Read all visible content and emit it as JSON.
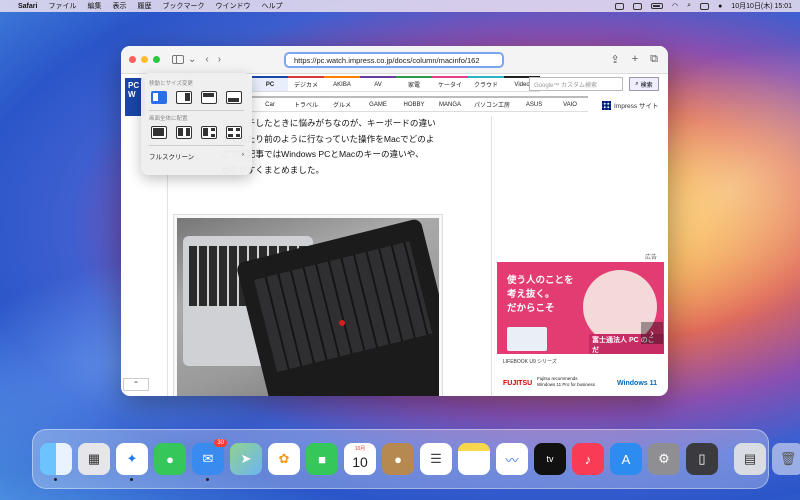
{
  "menubar": {
    "app_name": "Safari",
    "items": [
      "ファイル",
      "編集",
      "表示",
      "履歴",
      "ブックマーク",
      "ウインドウ",
      "ヘルプ"
    ],
    "datetime": "10月10日(木) 15:01"
  },
  "browser": {
    "url": "https://pc.watch.impress.co.jp/docs/column/macinfo/162"
  },
  "site": {
    "logo_text": "PC W",
    "nav_row1": [
      "PC",
      "デジカメ",
      "AKIBA",
      "AV",
      "家電",
      "ケータイ",
      "クラウド",
      "Video"
    ],
    "nav_row2": [
      "Car",
      "トラベル",
      "グルメ",
      "GAME",
      "HOBBY",
      "MANGA",
      "パソコン工房",
      "ASUS",
      "VAIO"
    ],
    "search_placeholder": "Google™ カスタム検索",
    "search_button": "検索",
    "impress_sites": "Impress サイト"
  },
  "article": {
    "lines": [
      "スイッチしたときに悩みがちなのが、キーボードの違い",
      "まで当たり前のように行なっていた操作をMacでどのよ",
      "こで本記事ではWindows PCとMacのキーの違いや、",
      "かりやすくまとめました。"
    ]
  },
  "ad": {
    "label": "広告",
    "headline": [
      "使う人のことを",
      "考え抜く。",
      "だからこそ"
    ],
    "corp": "富士通法人 PC のこだ",
    "product": "LIFEBOOK U9 シリーズ",
    "recommend": [
      "Fujitsu recommends",
      "Windows 11 Pro for business"
    ],
    "brand": "FUJITSU",
    "windows": "Windows 11"
  },
  "popover": {
    "section1_label": "移動とサイズ変更",
    "section2_label": "画面全体に配置",
    "fullscreen_label": "フルスクリーン"
  },
  "dock": {
    "mail_badge": "30",
    "calendar_month": "10月",
    "calendar_day": "10",
    "apps": [
      "Finder",
      "Launchpad",
      "Safari",
      "Messages",
      "Mail",
      "Maps",
      "Photos",
      "FaceTime",
      "Calendar",
      "Notes-ish",
      "Reminders",
      "Notes",
      "Freeform",
      "Apple TV",
      "Music",
      "App Store",
      "System Settings",
      "iPhone Mirroring",
      "Preview",
      "Trash"
    ]
  }
}
